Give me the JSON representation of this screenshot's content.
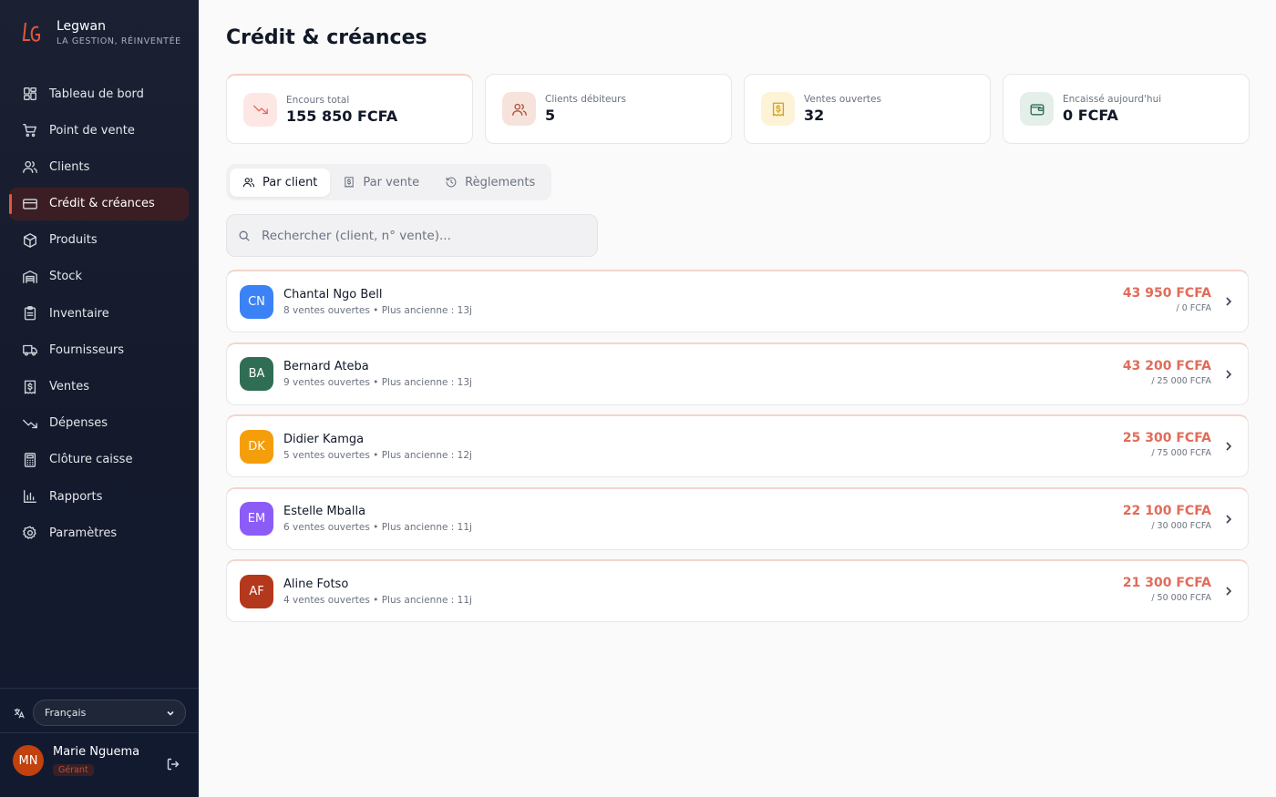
{
  "brand": {
    "name": "Legwan",
    "tagline": "LA GESTION, RÉINVENTÉE",
    "logo_icon": "legwan-logo"
  },
  "nav": [
    {
      "label": "Tableau de bord",
      "icon": "dashboard-icon"
    },
    {
      "label": "Point de vente",
      "icon": "cart-icon"
    },
    {
      "label": "Clients",
      "icon": "users-icon"
    },
    {
      "label": "Crédit & créances",
      "icon": "credit-card-icon",
      "active": true
    },
    {
      "label": "Produits",
      "icon": "box-icon"
    },
    {
      "label": "Stock",
      "icon": "warehouse-icon"
    },
    {
      "label": "Inventaire",
      "icon": "clipboard-icon"
    },
    {
      "label": "Fournisseurs",
      "icon": "truck-icon"
    },
    {
      "label": "Ventes",
      "icon": "receipt-icon"
    },
    {
      "label": "Dépenses",
      "icon": "trending-down-icon"
    },
    {
      "label": "Clôture caisse",
      "icon": "calculator-icon"
    },
    {
      "label": "Rapports",
      "icon": "bar-chart-icon"
    },
    {
      "label": "Paramètres",
      "icon": "gear-icon"
    }
  ],
  "language": {
    "selected": "Français"
  },
  "user": {
    "initials": "MN",
    "name": "Marie Nguema",
    "role": "Gérant"
  },
  "page": {
    "title": "Crédit & créances"
  },
  "kpis": [
    {
      "label": "Encours total",
      "value": "155 850 FCFA",
      "icon": "trending-down-icon",
      "bg": "#fde7e4",
      "fg": "#e06c5a"
    },
    {
      "label": "Clients débiteurs",
      "value": "5",
      "icon": "users-icon",
      "bg": "#f6e3dc",
      "fg": "#b4533c"
    },
    {
      "label": "Ventes ouvertes",
      "value": "32",
      "icon": "receipt-icon",
      "bg": "#fdf3d6",
      "fg": "#d6a21e"
    },
    {
      "label": "Encaissé aujourd'hui",
      "value": "0 FCFA",
      "icon": "wallet-icon",
      "bg": "#e5efe9",
      "fg": "#2f6e55"
    }
  ],
  "tabs": [
    {
      "label": "Par client",
      "icon": "users-icon",
      "active": true
    },
    {
      "label": "Par vente",
      "icon": "receipt-icon"
    },
    {
      "label": "Règlements",
      "icon": "history-icon"
    }
  ],
  "search": {
    "placeholder": "Rechercher (client, n° vente)...",
    "value": ""
  },
  "clients": [
    {
      "initials": "CN",
      "name": "Chantal Ngo Bell",
      "meta": "8 ventes ouvertes • Plus ancienne : 13j",
      "amount": "43 950 FCFA",
      "paid": "/ 0 FCFA",
      "color": "#3b82f6"
    },
    {
      "initials": "BA",
      "name": "Bernard Ateba",
      "meta": "9 ventes ouvertes • Plus ancienne : 13j",
      "amount": "43 200 FCFA",
      "paid": "/ 25 000 FCFA",
      "color": "#2f6e55"
    },
    {
      "initials": "DK",
      "name": "Didier Kamga",
      "meta": "5 ventes ouvertes • Plus ancienne : 12j",
      "amount": "25 300 FCFA",
      "paid": "/ 75 000 FCFA",
      "color": "#f59e0b"
    },
    {
      "initials": "EM",
      "name": "Estelle Mballa",
      "meta": "6 ventes ouvertes • Plus ancienne : 11j",
      "amount": "22 100 FCFA",
      "paid": "/ 30 000 FCFA",
      "color": "#8b5cf6"
    },
    {
      "initials": "AF",
      "name": "Aline Fotso",
      "meta": "4 ventes ouvertes • Plus ancienne : 11j",
      "amount": "21 300 FCFA",
      "paid": "/ 50 000 FCFA",
      "color": "#b4381c"
    }
  ]
}
